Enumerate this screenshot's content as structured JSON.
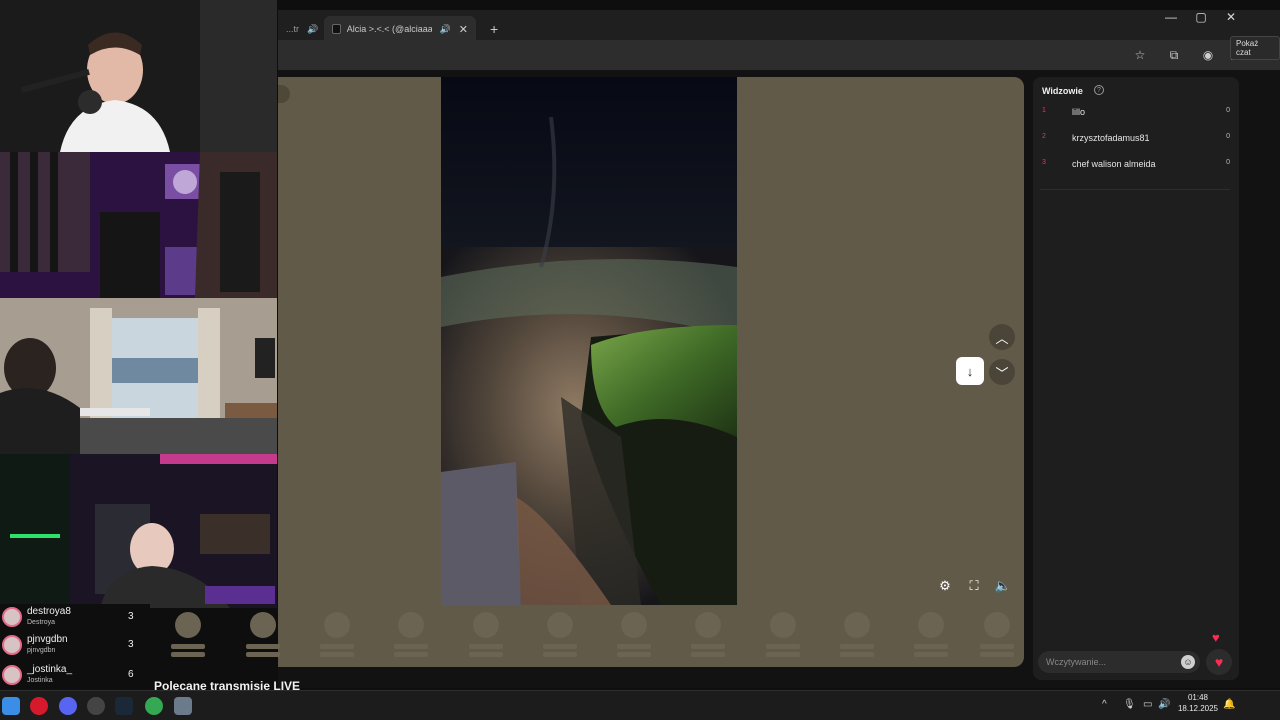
{
  "browser": {
    "tabs": [
      {
        "label": "...tr",
        "audio_icon": "speaker-icon",
        "close": "✕"
      },
      {
        "label": "Alcia >.<.< (@alciaaaxo) pro",
        "audio_icon": "speaker-icon",
        "close": "✕"
      }
    ],
    "new_tab": "+",
    "window_controls": {
      "minimize": "—",
      "maximize": "▢",
      "close": "✕"
    },
    "tooltip": "Pokaż czat"
  },
  "viewers": {
    "title": "Widzowie",
    "list": [
      {
        "rank": "1",
        "name": "lillo",
        "score": "0"
      },
      {
        "rank": "2",
        "name": "krzysztofadamus81",
        "score": "0"
      },
      {
        "rank": "3",
        "name": "chef walison almeida",
        "score": "0"
      }
    ]
  },
  "chat": {
    "placeholder": "Wczytywanie..."
  },
  "stream": {
    "featured_title": "Polecane transmisje LIVE"
  },
  "leaderboard": [
    {
      "name": "destroya8",
      "sub": "Destroya",
      "count": "3"
    },
    {
      "name": "pjnvgdbn",
      "sub": "pjnvgdbn",
      "count": "3"
    },
    {
      "name": "_jostinka_",
      "sub": "Jostinka",
      "count": "6"
    }
  ],
  "taskbar": {
    "time": "01:48",
    "date": "18.12.2025"
  },
  "colors": {
    "accent": "#fe2c55",
    "stage": "#625a49",
    "panel": "#1e1e1e"
  }
}
